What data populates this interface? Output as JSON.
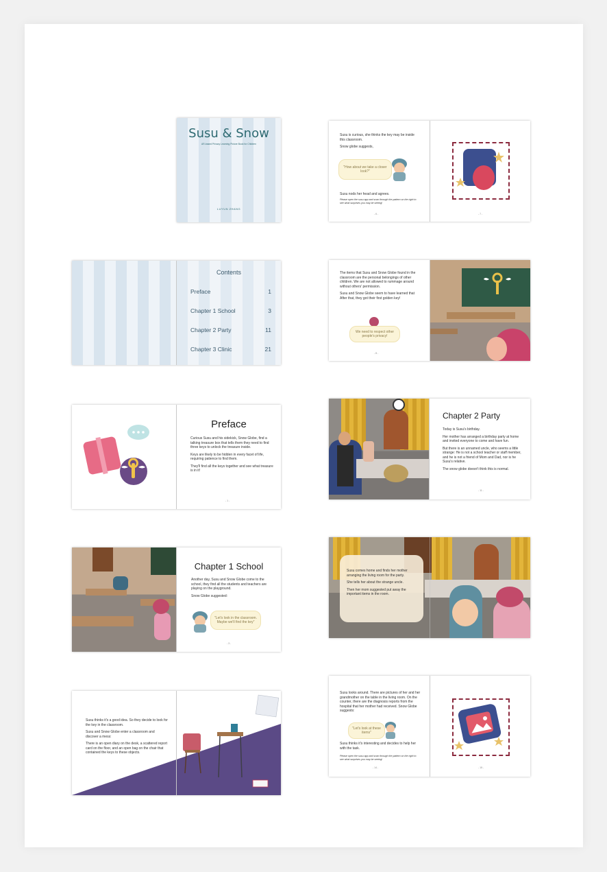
{
  "cover": {
    "title": "Susu & Snow",
    "subtitle": "AR-based Privacy Learning Picture Book for Children",
    "author": "LUYUN ZHANG"
  },
  "contents": {
    "heading": "Contents",
    "items": [
      {
        "label": "Preface",
        "page": "1"
      },
      {
        "label": "Chapter 1 School",
        "page": "3"
      },
      {
        "label": "Chapter 2 Party",
        "page": "11"
      },
      {
        "label": "Chapter 3 Clinic",
        "page": "21"
      }
    ]
  },
  "preface": {
    "heading": "Preface",
    "p1": "Curious Susu and his sidekick, Snow Globe, find a talking treasure box that tells them they need to find three keys to unlock the treasure inside.",
    "p2": "Keys are likely to be hidden in every facet of life, requiring patience to find them.",
    "p3": "They'll find all the keys together and see what treasure is in it!",
    "page": "- 1 -"
  },
  "chapter1": {
    "heading": "Chapter 1 School",
    "p1": "Another day, Susu and Snow Globe come to the school, they find all the students and teachers are playing on the playground.",
    "p2": "Snow Globe suggested:",
    "bubble": "\"Let's look in the classroom. Maybe we'll find the key\"",
    "page": "- 3 -"
  },
  "spread5": {
    "p1": "Susu thinks it's a good idea. So they decide to look for the key in the classroom.",
    "p2": "Susu and Snow Globe enter a classroom and discover a mess:",
    "p3": "There is an open diary on the desk, a scattered report card on the floor, and an open bag on the chair that contained the keys to these objects."
  },
  "spread6": {
    "p1": "Susu is curious, she thinks the key may be inside this classroom.",
    "p2": "Snow globe suggests,",
    "bubble": "\"How about we take a closer look?\"",
    "p3": "Susu nods her head and agrees.",
    "note": "Please open the susu app and scan through the pattern on the right to see what surprises you may be seeing!",
    "page_left": "- 6 -",
    "page_right": "- 7 -"
  },
  "spread7": {
    "p1": "The items that Susu and Snow Globe found in the classroom are the personal belongings of other children. We are not allowed to rummage around without others' permission.",
    "p2": "Susu and Snow Globe seem to have learned that",
    "p3": "After that, they got their first golden key!",
    "bubble": "We need to respect other people's privacy!",
    "page": "- 8 -"
  },
  "chapter2": {
    "heading": "Chapter 2 Party",
    "p1": "Today is Susu's birthday.",
    "p2": "Her mother has arranged a birthday party at home and invited everyone to come and have fun.",
    "p3": "But there is an unnamed uncle, who seems a little strange: He is not a school teacher or staff member, and he is not a friend of Mom and Dad, nor is he Susu's relative.",
    "p4": "The snow globe doesn't think this is normal.",
    "page": "- 11 -"
  },
  "spread9": {
    "p1": "Susu comes home and finds her mother arranging the living room for the party.",
    "p2": "She tells her about the strange uncle.",
    "p3": "Then her mom suggested put away the important items in the room."
  },
  "spread10": {
    "p1": "Susu looks around. There are pictures of her and her grandmother on the table in the living room. On the counter, there are the diagnosis reports from the hospital that her mother had received. Snow Globe suggests:",
    "bubble": "\"Let's look at these items\"",
    "p2": "Susu thinks it's interesting and decides to help her with the task.",
    "note": "Please open the susu app and scan through the pattern on the right to see what surprises you may be seeing!",
    "page_left": "- 14 -",
    "page_right": "- 15 -"
  }
}
